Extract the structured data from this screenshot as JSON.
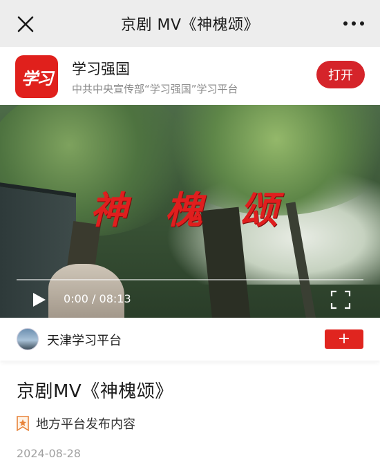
{
  "topbar": {
    "title": "京剧 MV《神槐颂》",
    "close_icon": "close-icon",
    "more_icon": "more-icon"
  },
  "app": {
    "logo_text": "学习",
    "name": "学习强国",
    "description": "中共中央宣传部“学习强国”学习平台",
    "open_label": "打开",
    "brand_color": "#d5242a"
  },
  "video": {
    "overlay_title": "神 槐 颂",
    "time_current": "0:00",
    "time_separator": "/",
    "time_total": "08:13",
    "progress": 0
  },
  "channel": {
    "name": "天津学习平台",
    "follow_label": "+"
  },
  "article": {
    "title": "京剧MV《神槐颂》",
    "tag": "地方平台发布内容",
    "date": "2024-08-28"
  }
}
